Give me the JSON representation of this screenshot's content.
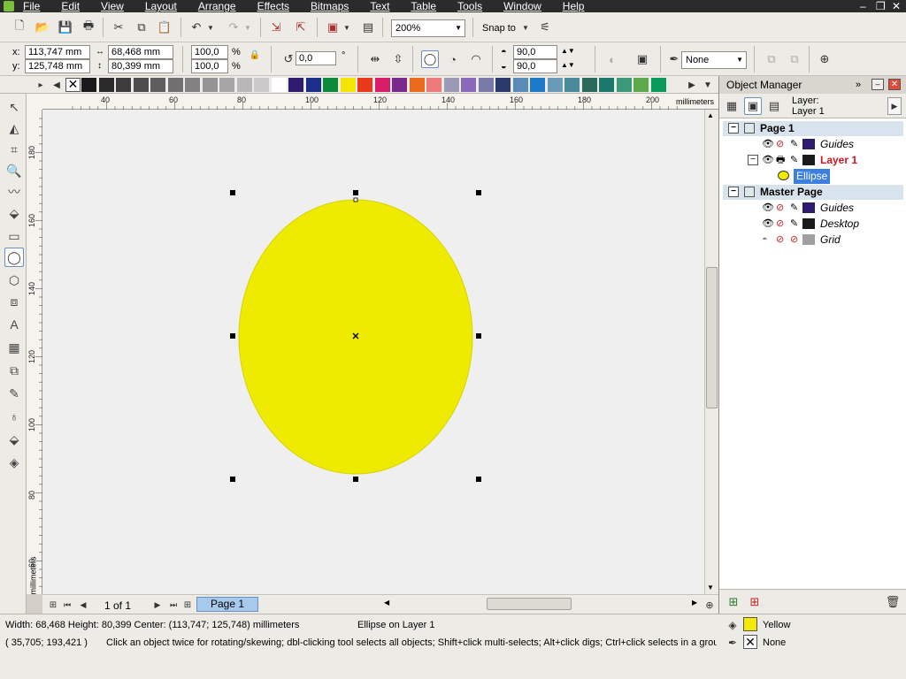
{
  "menu": [
    "File",
    "Edit",
    "View",
    "Layout",
    "Arrange",
    "Effects",
    "Bitmaps",
    "Text",
    "Table",
    "Tools",
    "Window",
    "Help"
  ],
  "standard_toolbar": {
    "zoom": "200%",
    "snap_to": "Snap to"
  },
  "property_bar": {
    "x_label": "x:",
    "y_label": "y:",
    "x": "113,747 mm",
    "y": "125,748 mm",
    "width": "68,468 mm",
    "height": "80,399 mm",
    "scale_x": "100,0",
    "scale_y": "100,0",
    "percent": "%",
    "rotation": "0,0",
    "degree": "°",
    "start_angle": "90,0",
    "end_angle": "90,0",
    "outline": "None"
  },
  "palette_colors": [
    "#1a1a1a",
    "#2a2a2a",
    "#3c3c3c",
    "#4d4d4d",
    "#5e5e5e",
    "#707070",
    "#828282",
    "#949494",
    "#a6a6a6",
    "#b8b8b8",
    "#cacaca",
    "#ffffff",
    "#2e1a6e",
    "#1c2e8c",
    "#0a8a3a",
    "#f2e600",
    "#e83a1a",
    "#d81e6a",
    "#7a2a8a",
    "#e86a1a",
    "#f07a7a",
    "#9a9ab8",
    "#8a6ab8",
    "#7a7aa8",
    "#2a3a6a",
    "#5a8ab8",
    "#1a7ac8",
    "#6a9ab8",
    "#4a8a9a",
    "#2a6a5a",
    "#1a7a6a",
    "#3a9a7a",
    "#5aaa4a",
    "#0a9a5a"
  ],
  "ruler": {
    "h_ticks": [
      "40",
      "60",
      "80",
      "100",
      "120",
      "140",
      "160",
      "180",
      "200"
    ],
    "unit": "millimeters",
    "v_ticks": [
      "180",
      "160",
      "140",
      "120",
      "100",
      "80",
      "60"
    ],
    "v_unit": "millimeters"
  },
  "ellipse": {
    "fill": "#eeea00",
    "outline": "#d8d400"
  },
  "page_nav": {
    "count": "1 of 1",
    "tab": "Page 1"
  },
  "status": {
    "dimensions": "Width: 68,468  Height: 80,399  Center: (113,747; 125,748)  millimeters",
    "object": "Ellipse on Layer 1",
    "coords": "( 35,705; 193,421 )",
    "hint": "Click an object twice for rotating/skewing; dbl-clicking tool selects all objects; Shift+click multi-selects; Alt+click digs; Ctrl+click selects in a group",
    "fill_name": "Yellow",
    "fill_color": "#f2ea00",
    "outline_name": "None"
  },
  "object_manager": {
    "title": "Object Manager",
    "layer_label": "Layer:",
    "layer_value": "Layer 1",
    "tree": [
      {
        "label": "Page 1",
        "kind": "group"
      },
      {
        "label": "Guides",
        "kind": "layer",
        "color": "#2e1a6e"
      },
      {
        "label": "Layer 1",
        "kind": "layer-active",
        "color": "#1a1a1a"
      },
      {
        "label": "Ellipse",
        "kind": "object"
      },
      {
        "label": "Master Page",
        "kind": "group"
      },
      {
        "label": "Guides",
        "kind": "layer",
        "color": "#2e1a6e"
      },
      {
        "label": "Desktop",
        "kind": "layer",
        "color": "#1a1a1a"
      },
      {
        "label": "Grid",
        "kind": "layer",
        "color": "#a0a0a0"
      }
    ]
  }
}
